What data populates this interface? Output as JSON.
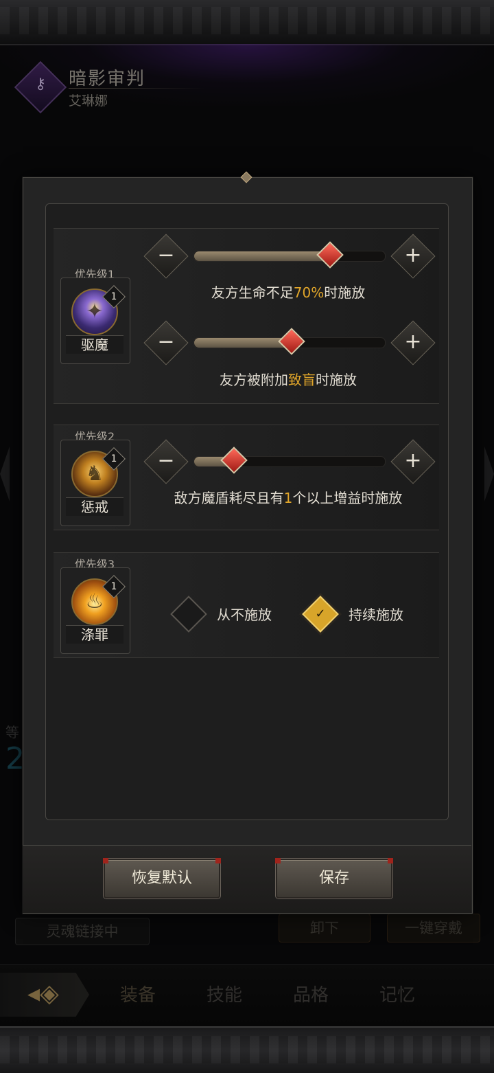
{
  "header": {
    "skill_name": "暗影审判",
    "hero_name": "艾琳娜"
  },
  "colors": {
    "highlight": "#e0a52a",
    "slider_fill": "#8a7a60",
    "thumb": "#d83a2c"
  },
  "rules": [
    {
      "priority_label": "优先级1",
      "skill_title": "驱魔",
      "skill_level": "1",
      "icon": "exorcism-skill-icon",
      "conditions": [
        {
          "prefix": "友方生命不足",
          "highlight": "70%",
          "suffix": "时施放",
          "slider_fraction": 0.7
        },
        {
          "prefix": "友方被附加",
          "highlight": "致盲",
          "suffix": "时施放",
          "slider_fraction": 0.5
        }
      ]
    },
    {
      "priority_label": "优先级2",
      "skill_title": "惩戒",
      "skill_level": "1",
      "icon": "punish-skill-icon",
      "conditions": [
        {
          "prefix": "敌方魔盾耗尽且有",
          "highlight": "1",
          "suffix": "个以上增益时施放",
          "slider_fraction": 0.2
        }
      ]
    },
    {
      "priority_label": "优先级3",
      "skill_title": "涤罪",
      "skill_level": "1",
      "icon": "purify-skill-icon",
      "options": [
        {
          "label": "从不施放",
          "selected": false
        },
        {
          "label": "持续施放",
          "selected": true
        }
      ]
    }
  ],
  "controls": {
    "minus": "−",
    "plus": "+"
  },
  "footer": {
    "reset_label": "恢复默认",
    "save_label": "保存"
  },
  "background": {
    "soul_link_label": "灵魂链接中",
    "unequip_label": "卸下",
    "equip_all_label": "一键穿戴",
    "side_partial_text": "等",
    "side_partial_number": "2"
  },
  "tabs": [
    {
      "label": "装备",
      "active": true
    },
    {
      "label": "技能",
      "active": false
    },
    {
      "label": "品格",
      "active": false
    },
    {
      "label": "记忆",
      "active": false
    }
  ]
}
